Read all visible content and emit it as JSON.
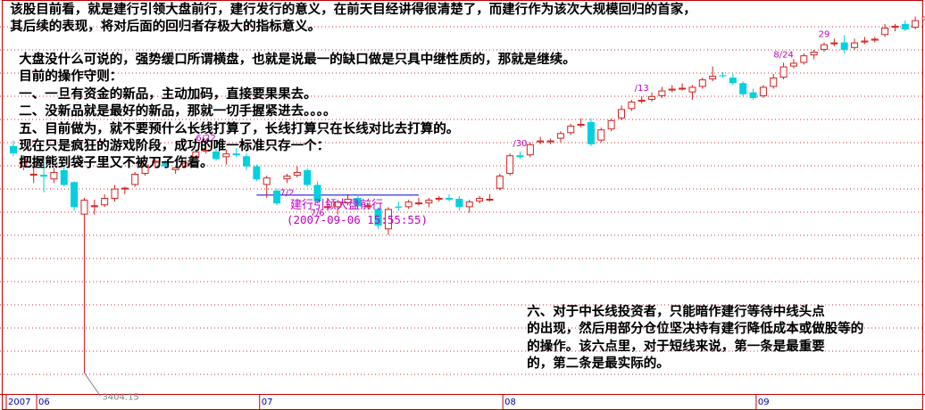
{
  "notes": {
    "top": [
      "该股目前看，就是建行引领大盘前行，建行发行的意义，在前天目经讲得很清楚了，而建行作为该次大规模回归的首家，",
      "其后续的表现，将对后面的回归者存极大的指标意义。"
    ],
    "middle": [
      "大盘没什么可说的，强势缓口所谓横盘，也就是说最一的缺口做是只具中继性质的，那就是继续。",
      "目前的操作守则：",
      "一、一旦有资金的新品，主动加码，直接要果果去。",
      "二、没新品就是最好的新品，那就一切手握紧进去。。。。",
      "五、目前做为，就不要预什么长线打算了，长线打算只在长线对比去打算的。",
      "现在只是疯狂的游戏阶段，成功的唯一标准只存一个：",
      "把握熊到袋子里又不被刀子伤着。"
    ],
    "bottom": [
      "六、对于中长线投资者，只能暗作建行等待中线头点",
      "的出现，然后用部分仓位坚决持有建行降低成本或做股等的",
      "的操作。该六点里，对于短线来说，第一条是最重要",
      "的，第二条是最实际的。"
    ]
  },
  "banner": {
    "title": "建行引领大盘前行",
    "datetime": "(2007-09-06 15:55:55)"
  },
  "chart_data": {
    "type": "candlestick",
    "title": "",
    "xlabel": "",
    "ylabel": "",
    "colors": {
      "up": "#d42020",
      "down": "#00d0e0",
      "doji": "#00d0e0",
      "grid": "#c00000",
      "date_label": "#c000c0",
      "support_line": "#0000cc",
      "axis_text": "#0000a0",
      "low_marker": "#808080"
    },
    "ylim": [
      3300,
      5400
    ],
    "grid": "dashed-horizontal",
    "candles": [
      {
        "o": 4630,
        "c": 4590,
        "h": 4660,
        "l": 4575
      },
      {
        "o": 4520,
        "c": 4560,
        "h": 4580,
        "l": 4500
      },
      {
        "o": 4470,
        "c": 4480,
        "h": 4570,
        "l": 4430
      },
      {
        "o": 4475,
        "c": 4465,
        "h": 4560,
        "l": 4380
      },
      {
        "o": 4450,
        "c": 4490,
        "h": 4510,
        "l": 4430
      },
      {
        "o": 4500,
        "c": 4420,
        "h": 4520,
        "l": 4410
      },
      {
        "o": 4435,
        "c": 4300,
        "h": 4440,
        "l": 4280
      },
      {
        "o": 4260,
        "c": 4340,
        "h": 4350,
        "l": 3404.15
      },
      {
        "o": 4300,
        "c": 4310,
        "h": 4340,
        "l": 4260
      },
      {
        "o": 4310,
        "c": 4350,
        "h": 4370,
        "l": 4300
      },
      {
        "o": 4345,
        "c": 4400,
        "h": 4420,
        "l": 4330
      },
      {
        "o": 4400,
        "c": 4405,
        "h": 4410,
        "l": 4370
      },
      {
        "o": 4420,
        "c": 4480,
        "h": 4490,
        "l": 4410
      },
      {
        "o": 4480,
        "c": 4530,
        "h": 4540,
        "l": 4470
      },
      {
        "o": 4540,
        "c": 4550,
        "h": 4560,
        "l": 4510
      },
      {
        "o": 4540,
        "c": 4520,
        "h": 4555,
        "l": 4510
      },
      {
        "o": 4500,
        "c": 4515,
        "h": 4520,
        "l": 4480
      },
      {
        "o": 4520,
        "c": 4540,
        "h": 4570,
        "l": 4510
      },
      {
        "o": 4570,
        "c": 4600,
        "h": 4610,
        "l": 4560
      },
      {
        "o": 4600,
        "c": 4610,
        "h": 4630,
        "l": 4590
      },
      {
        "o": 4600,
        "c": 4560,
        "h": 4620,
        "l": 4550
      },
      {
        "o": 4570,
        "c": 4590,
        "h": 4610,
        "l": 4530
      },
      {
        "o": 4590,
        "c": 4580,
        "h": 4620,
        "l": 4570
      },
      {
        "o": 4575,
        "c": 4520,
        "h": 4590,
        "l": 4500
      },
      {
        "o": 4520,
        "c": 4450,
        "h": 4530,
        "l": 4440
      },
      {
        "o": 4420,
        "c": 4460,
        "h": 4470,
        "l": 4350
      },
      {
        "o": 4390,
        "c": 4320,
        "h": 4400,
        "l": 4310
      },
      {
        "o": 4450,
        "c": 4470,
        "h": 4480,
        "l": 4430
      },
      {
        "o": 4470,
        "c": 4490,
        "h": 4520,
        "l": 4460
      },
      {
        "o": 4500,
        "c": 4420,
        "h": 4510,
        "l": 4410
      },
      {
        "o": 4420,
        "c": 4330,
        "h": 4440,
        "l": 4320
      },
      {
        "o": 4300,
        "c": 4305,
        "h": 4350,
        "l": 4280
      },
      {
        "o": 4300,
        "c": 4330,
        "h": 4340,
        "l": 4260
      },
      {
        "o": 4320,
        "c": 4345,
        "h": 4370,
        "l": 4310
      },
      {
        "o": 4350,
        "c": 4305,
        "h": 4360,
        "l": 4300
      },
      {
        "o": 4300,
        "c": 4310,
        "h": 4320,
        "l": 4290
      },
      {
        "o": 4290,
        "c": 4200,
        "h": 4300,
        "l": 4180
      },
      {
        "o": 4180,
        "c": 4290,
        "h": 4300,
        "l": 4150
      },
      {
        "o": 4300,
        "c": 4300,
        "h": 4330,
        "l": 4280
      },
      {
        "o": 4300,
        "c": 4330,
        "h": 4340,
        "l": 4290
      },
      {
        "o": 4320,
        "c": 4325,
        "h": 4350,
        "l": 4310
      },
      {
        "o": 4320,
        "c": 4340,
        "h": 4350,
        "l": 4300
      },
      {
        "o": 4340,
        "c": 4350,
        "h": 4360,
        "l": 4330
      },
      {
        "o": 4350,
        "c": 4340,
        "h": 4370,
        "l": 4330
      },
      {
        "o": 4345,
        "c": 4300,
        "h": 4360,
        "l": 4280
      },
      {
        "o": 4300,
        "c": 4330,
        "h": 4340,
        "l": 4270
      },
      {
        "o": 4330,
        "c": 4350,
        "h": 4360,
        "l": 4320
      },
      {
        "o": 4340,
        "c": 4345,
        "h": 4370,
        "l": 4330
      },
      {
        "o": 4400,
        "c": 4470,
        "h": 4480,
        "l": 4390
      },
      {
        "o": 4480,
        "c": 4580,
        "h": 4590,
        "l": 4470
      },
      {
        "o": 4580,
        "c": 4570,
        "h": 4600,
        "l": 4560
      },
      {
        "o": 4580,
        "c": 4640,
        "h": 4650,
        "l": 4570
      },
      {
        "o": 4650,
        "c": 4660,
        "h": 4680,
        "l": 4640
      },
      {
        "o": 4655,
        "c": 4660,
        "h": 4670,
        "l": 4640
      },
      {
        "o": 4670,
        "c": 4700,
        "h": 4710,
        "l": 4650
      },
      {
        "o": 4700,
        "c": 4740,
        "h": 4750,
        "l": 4690
      },
      {
        "o": 4740,
        "c": 4750,
        "h": 4780,
        "l": 4730
      },
      {
        "o": 4760,
        "c": 4640,
        "h": 4780,
        "l": 4630
      },
      {
        "o": 4660,
        "c": 4720,
        "h": 4730,
        "l": 4650
      },
      {
        "o": 4720,
        "c": 4770,
        "h": 4780,
        "l": 4710
      },
      {
        "o": 4780,
        "c": 4830,
        "h": 4850,
        "l": 4770
      },
      {
        "o": 4830,
        "c": 4870,
        "h": 4880,
        "l": 4820
      },
      {
        "o": 4870,
        "c": 4880,
        "h": 4900,
        "l": 4860
      },
      {
        "o": 4880,
        "c": 4900,
        "h": 4920,
        "l": 4870
      },
      {
        "o": 4900,
        "c": 4930,
        "h": 4950,
        "l": 4890
      },
      {
        "o": 4930,
        "c": 4940,
        "h": 4960,
        "l": 4920
      },
      {
        "o": 4940,
        "c": 4945,
        "h": 4970,
        "l": 4930
      },
      {
        "o": 4920,
        "c": 4950,
        "h": 4960,
        "l": 4880
      },
      {
        "o": 4950,
        "c": 4990,
        "h": 5000,
        "l": 4940
      },
      {
        "o": 4990,
        "c": 5010,
        "h": 5060,
        "l": 4980
      },
      {
        "o": 5010,
        "c": 5010,
        "h": 5030,
        "l": 5000
      },
      {
        "o": 5000,
        "c": 4970,
        "h": 5020,
        "l": 4960
      },
      {
        "o": 4970,
        "c": 4910,
        "h": 4980,
        "l": 4900
      },
      {
        "o": 4920,
        "c": 4890,
        "h": 4940,
        "l": 4880
      },
      {
        "o": 4900,
        "c": 4950,
        "h": 4960,
        "l": 4890
      },
      {
        "o": 4950,
        "c": 5000,
        "h": 5020,
        "l": 4940
      },
      {
        "o": 5000,
        "c": 5060,
        "h": 5080,
        "l": 4990
      },
      {
        "o": 5060,
        "c": 5080,
        "h": 5100,
        "l": 5050
      },
      {
        "o": 5080,
        "c": 5120,
        "h": 5130,
        "l": 5070
      },
      {
        "o": 5120,
        "c": 5140,
        "h": 5150,
        "l": 5100
      },
      {
        "o": 5150,
        "c": 5180,
        "h": 5190,
        "l": 5140
      },
      {
        "o": 5180,
        "c": 5190,
        "h": 5210,
        "l": 5170
      },
      {
        "o": 5190,
        "c": 5150,
        "h": 5230,
        "l": 5130
      },
      {
        "o": 5160,
        "c": 5190,
        "h": 5210,
        "l": 5150
      },
      {
        "o": 5190,
        "c": 5200,
        "h": 5220,
        "l": 5180
      },
      {
        "o": 5200,
        "c": 5210,
        "h": 5220,
        "l": 5190
      },
      {
        "o": 5230,
        "c": 5270,
        "h": 5290,
        "l": 5220
      },
      {
        "o": 5270,
        "c": 5280,
        "h": 5290,
        "l": 5250
      },
      {
        "o": 5290,
        "c": 5260,
        "h": 5310,
        "l": 5250
      },
      {
        "o": 5270,
        "c": 5310,
        "h": 5330,
        "l": 5260
      },
      {
        "o": 5310,
        "c": 5330,
        "h": 5340,
        "l": 5250
      }
    ],
    "date_labels": [
      {
        "candle": 19,
        "text": "6/22",
        "pos": "above"
      },
      {
        "candle": 27,
        "text": "7/2",
        "pos": "below"
      },
      {
        "candle": 30,
        "text": "7/6",
        "pos": "below"
      },
      {
        "candle": 50,
        "text": "/30",
        "pos": "above"
      },
      {
        "candle": 62,
        "text": "/13",
        "pos": "above"
      },
      {
        "candle": 76,
        "text": "8/24",
        "pos": "above"
      },
      {
        "candle": 80,
        "text": "29",
        "pos": "above"
      }
    ],
    "low_marker": {
      "candle": 7,
      "text": "3404.15"
    },
    "support_line": {
      "from_candle": 24,
      "to_candle": 40,
      "value": 4365
    },
    "x_axis_labels": [
      {
        "candle": 0,
        "text": "2007"
      },
      {
        "candle": 3,
        "text": "06"
      },
      {
        "candle": 25,
        "text": "07"
      },
      {
        "candle": 49,
        "text": "08"
      },
      {
        "candle": 74,
        "text": "09"
      }
    ]
  }
}
